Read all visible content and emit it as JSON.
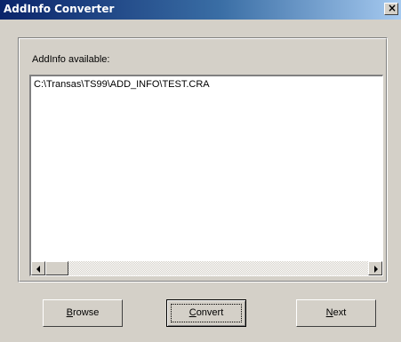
{
  "window": {
    "title": "AddInfo Converter",
    "close_glyph": "×"
  },
  "group": {
    "label": "AddInfo available:"
  },
  "list": {
    "items": [
      "C:\\Transas\\TS99\\ADD_INFO\\TEST.CRA"
    ]
  },
  "buttons": {
    "browse": {
      "mnemonic": "B",
      "rest": "rowse"
    },
    "convert": {
      "mnemonic": "C",
      "rest": "onvert"
    },
    "next": {
      "mnemonic": "N",
      "rest": "ext"
    }
  },
  "colors": {
    "face": "#d4d0c8",
    "title_start": "#0a246a",
    "title_end": "#a6caf0"
  },
  "icons": [
    "close-icon",
    "scroll-left-icon",
    "scroll-right-icon"
  ]
}
